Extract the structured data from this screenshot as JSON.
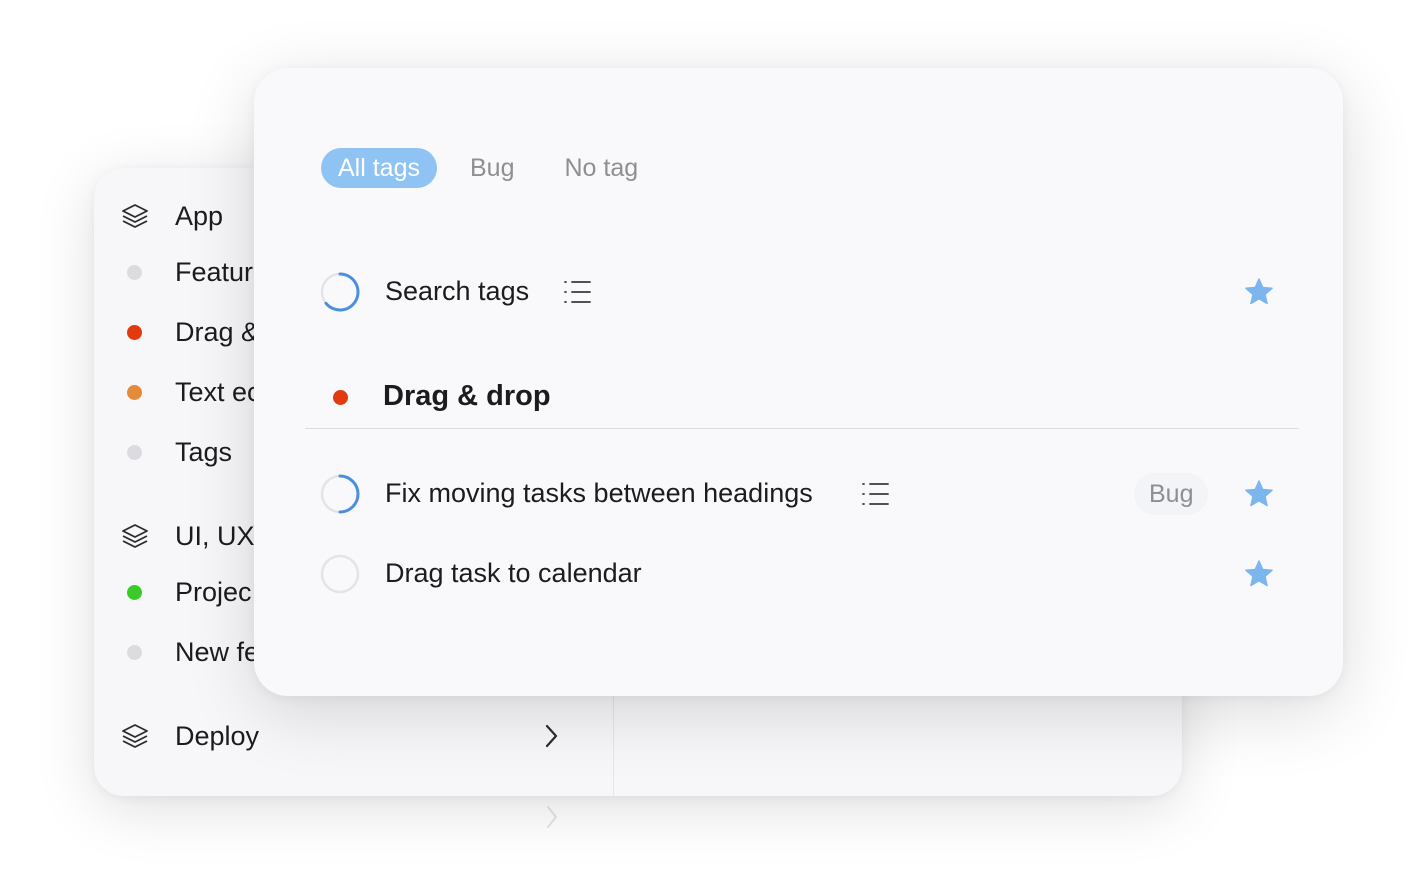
{
  "colors": {
    "accent": "#4a8fe0",
    "star": "#7db6ef",
    "tab_active_bg": "#8ec3f4",
    "red": "#e2390f",
    "orange": "#e58a3a",
    "green": "#3cc92a",
    "gray_dot": "#dcdce0"
  },
  "sidebar": {
    "items": [
      {
        "type": "group",
        "icon": "layers-icon",
        "label": "App"
      },
      {
        "type": "project",
        "color": "#dcdce0",
        "label": "Featur"
      },
      {
        "type": "project",
        "color": "#e2390f",
        "label": "Drag &"
      },
      {
        "type": "project",
        "color": "#e58a3a",
        "label": "Text ec"
      },
      {
        "type": "project",
        "color": "#dcdce0",
        "label": "Tags"
      },
      {
        "type": "group",
        "icon": "layers-icon",
        "label": "UI, UX"
      },
      {
        "type": "project",
        "color": "#3cc92a",
        "label": "Projec"
      },
      {
        "type": "project",
        "color": "#dcdce0",
        "label": "New fe"
      },
      {
        "type": "group",
        "icon": "layers-icon",
        "label": "Deploy"
      }
    ]
  },
  "filters": {
    "tabs": [
      {
        "label": "All tags",
        "active": true
      },
      {
        "label": "Bug",
        "active": false
      },
      {
        "label": "No tag",
        "active": false
      }
    ]
  },
  "tasks": [
    {
      "title": "Search tags",
      "status": "in-progress",
      "has_notes": true,
      "starred": true,
      "tag": ""
    },
    {
      "title": "Fix moving tasks between headings",
      "status": "in-progress",
      "has_notes": true,
      "starred": true,
      "tag": "Bug"
    },
    {
      "title": "Drag task to calendar",
      "status": "open",
      "has_notes": false,
      "starred": true,
      "tag": ""
    }
  ],
  "heading": {
    "title": "Drag & drop",
    "color": "#e2390f"
  }
}
